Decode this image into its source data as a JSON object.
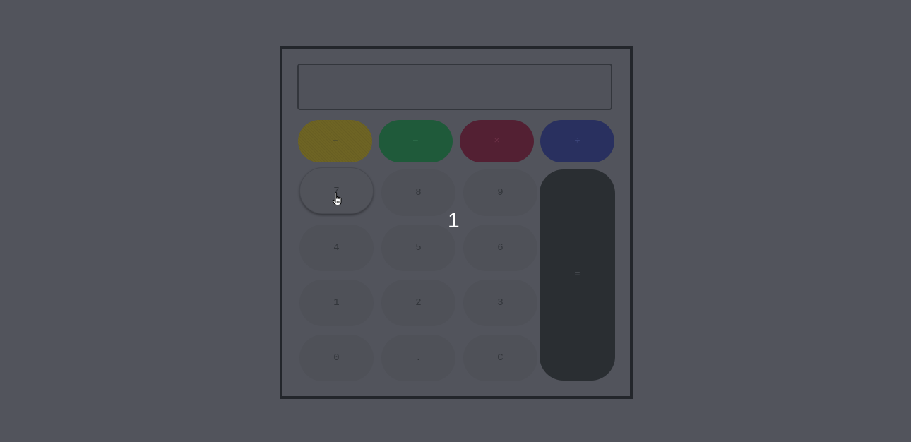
{
  "display": {
    "value": ""
  },
  "operators": {
    "plus": "+",
    "minus": "−",
    "times": "×",
    "divide": "÷"
  },
  "keys": {
    "k7": "7",
    "k8": "8",
    "k9": "9",
    "k4": "4",
    "k5": "5",
    "k6": "6",
    "k1": "1",
    "k2": "2",
    "k3": "3",
    "k0": "0",
    "dot": ".",
    "clear": "C",
    "equals": "="
  },
  "overlay": {
    "digit": "1"
  },
  "icons": {
    "cursor": "hand-pointer-icon"
  },
  "colors": {
    "background": "#52545c",
    "plus": "#6e6424",
    "minus": "#1f5a3a",
    "times": "#532033",
    "divide": "#29305f",
    "equals": "#2a2e32",
    "frame": "#23262b"
  }
}
